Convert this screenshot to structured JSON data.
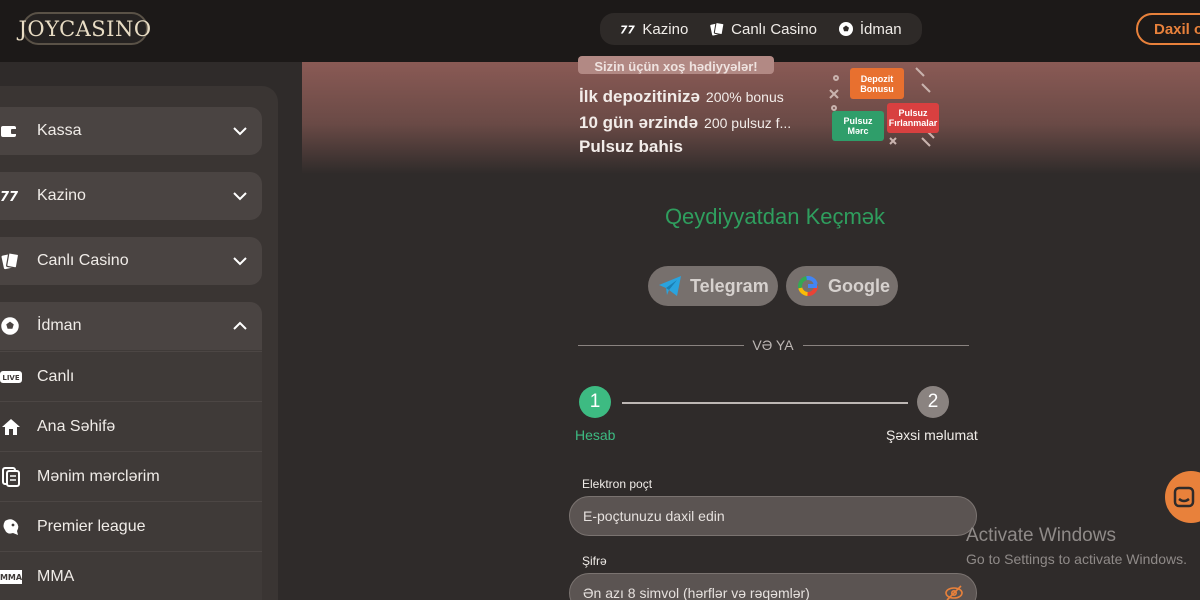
{
  "header": {
    "logo": "JOYCASINO",
    "nav": [
      {
        "label": "Kazino",
        "icon": "slot-777-icon"
      },
      {
        "label": "Canlı Casino",
        "icon": "playing-cards-icon"
      },
      {
        "label": "İdman",
        "icon": "soccer-ball-icon"
      }
    ],
    "login_label": "Daxil ol"
  },
  "sidebar": {
    "items": [
      {
        "label": "Kassa",
        "icon": "wallet-icon"
      },
      {
        "label": "Kazino",
        "icon": "slot-777-icon"
      },
      {
        "label": "Canlı Casino",
        "icon": "playing-cards-icon"
      }
    ],
    "sport": {
      "label": "İdman",
      "icon": "soccer-ball-icon",
      "subitems": [
        {
          "label": "Canlı",
          "icon": "live-badge-icon",
          "badge": "LIVE"
        },
        {
          "label": "Ana Səhifə",
          "icon": "home-icon"
        },
        {
          "label": "Mənim mərclərim",
          "icon": "bet-slip-icon"
        },
        {
          "label": "Premier league",
          "icon": "lion-icon"
        },
        {
          "label": "MMA",
          "icon": "mma-icon",
          "badge": "MMA"
        }
      ]
    }
  },
  "banner": {
    "tag": "Sizin üçün xoş hədiyyələr!",
    "lines": [
      {
        "bold": "İlk depozitinizə",
        "small": "200% bonus"
      },
      {
        "bold": "10 gün ərzində",
        "small": "200 pulsuz f..."
      },
      {
        "bold": "Pulsuz bahis",
        "small": ""
      }
    ],
    "chips": {
      "deposit": "Depozit Bonusu",
      "free_bet": "Pulsuz Mərc",
      "free_spins": "Pulsuz Fırlanmalar"
    }
  },
  "registration": {
    "title": "Qeydiyyatdan Keçmək",
    "telegram_label": "Telegram",
    "google_label": "Google",
    "or_label": "VƏ YA",
    "step1_num": "1",
    "step1_label": "Hesab",
    "step2_num": "2",
    "step2_label": "Şəxsi məlumat",
    "email_label": "Elektron poçt",
    "email_placeholder": "E-poçtunuzu daxil edin",
    "password_label": "Şifrə",
    "password_placeholder": "Ən azı 8 simvol (hərflər və rəqəmlər)"
  },
  "watermark": {
    "line1": "Activate Windows",
    "line2": "Go to Settings to activate Windows."
  },
  "colors": {
    "accent_orange": "#e8813b",
    "accent_green": "#2f9e5e",
    "step_active": "#3dbb82"
  }
}
